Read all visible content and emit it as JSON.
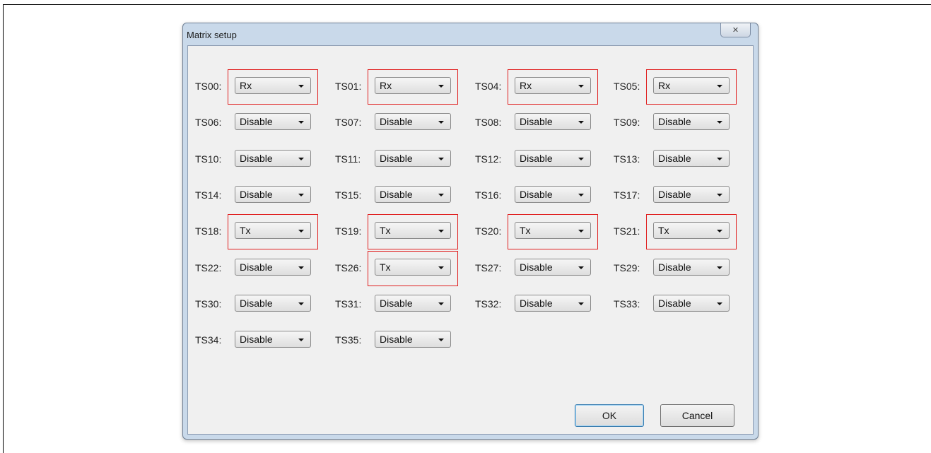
{
  "dialog": {
    "title": "Matrix setup",
    "close_symbol": "✕",
    "ok_label": "OK",
    "cancel_label": "Cancel"
  },
  "slots": [
    {
      "label": "TS00:",
      "value": "Rx",
      "highlighted": true
    },
    {
      "label": "TS01:",
      "value": "Rx",
      "highlighted": true
    },
    {
      "label": "TS04:",
      "value": "Rx",
      "highlighted": true
    },
    {
      "label": "TS05:",
      "value": "Rx",
      "highlighted": true
    },
    {
      "label": "TS06:",
      "value": "Disable",
      "highlighted": false
    },
    {
      "label": "TS07:",
      "value": "Disable",
      "highlighted": false
    },
    {
      "label": "TS08:",
      "value": "Disable",
      "highlighted": false
    },
    {
      "label": "TS09:",
      "value": "Disable",
      "highlighted": false
    },
    {
      "label": "TS10:",
      "value": "Disable",
      "highlighted": false
    },
    {
      "label": "TS11:",
      "value": "Disable",
      "highlighted": false
    },
    {
      "label": "TS12:",
      "value": "Disable",
      "highlighted": false
    },
    {
      "label": "TS13:",
      "value": "Disable",
      "highlighted": false
    },
    {
      "label": "TS14:",
      "value": "Disable",
      "highlighted": false
    },
    {
      "label": "TS15:",
      "value": "Disable",
      "highlighted": false
    },
    {
      "label": "TS16:",
      "value": "Disable",
      "highlighted": false
    },
    {
      "label": "TS17:",
      "value": "Disable",
      "highlighted": false
    },
    {
      "label": "TS18:",
      "value": "Tx",
      "highlighted": true
    },
    {
      "label": "TS19:",
      "value": "Tx",
      "highlighted": true
    },
    {
      "label": "TS20:",
      "value": "Tx",
      "highlighted": true
    },
    {
      "label": "TS21:",
      "value": "Tx",
      "highlighted": true
    },
    {
      "label": "TS22:",
      "value": "Disable",
      "highlighted": false
    },
    {
      "label": "TS26:",
      "value": "Tx",
      "highlighted": true
    },
    {
      "label": "TS27:",
      "value": "Disable",
      "highlighted": false
    },
    {
      "label": "TS29:",
      "value": "Disable",
      "highlighted": false
    },
    {
      "label": "TS30:",
      "value": "Disable",
      "highlighted": false
    },
    {
      "label": "TS31:",
      "value": "Disable",
      "highlighted": false
    },
    {
      "label": "TS32:",
      "value": "Disable",
      "highlighted": false
    },
    {
      "label": "TS33:",
      "value": "Disable",
      "highlighted": false
    },
    {
      "label": "TS34:",
      "value": "Disable",
      "highlighted": false
    },
    {
      "label": "TS35:",
      "value": "Disable",
      "highlighted": false
    }
  ],
  "colors": {
    "highlight": "#e02020",
    "dialog_bg": "#f0f0f0",
    "frame_bg": "#c9d9ea"
  }
}
